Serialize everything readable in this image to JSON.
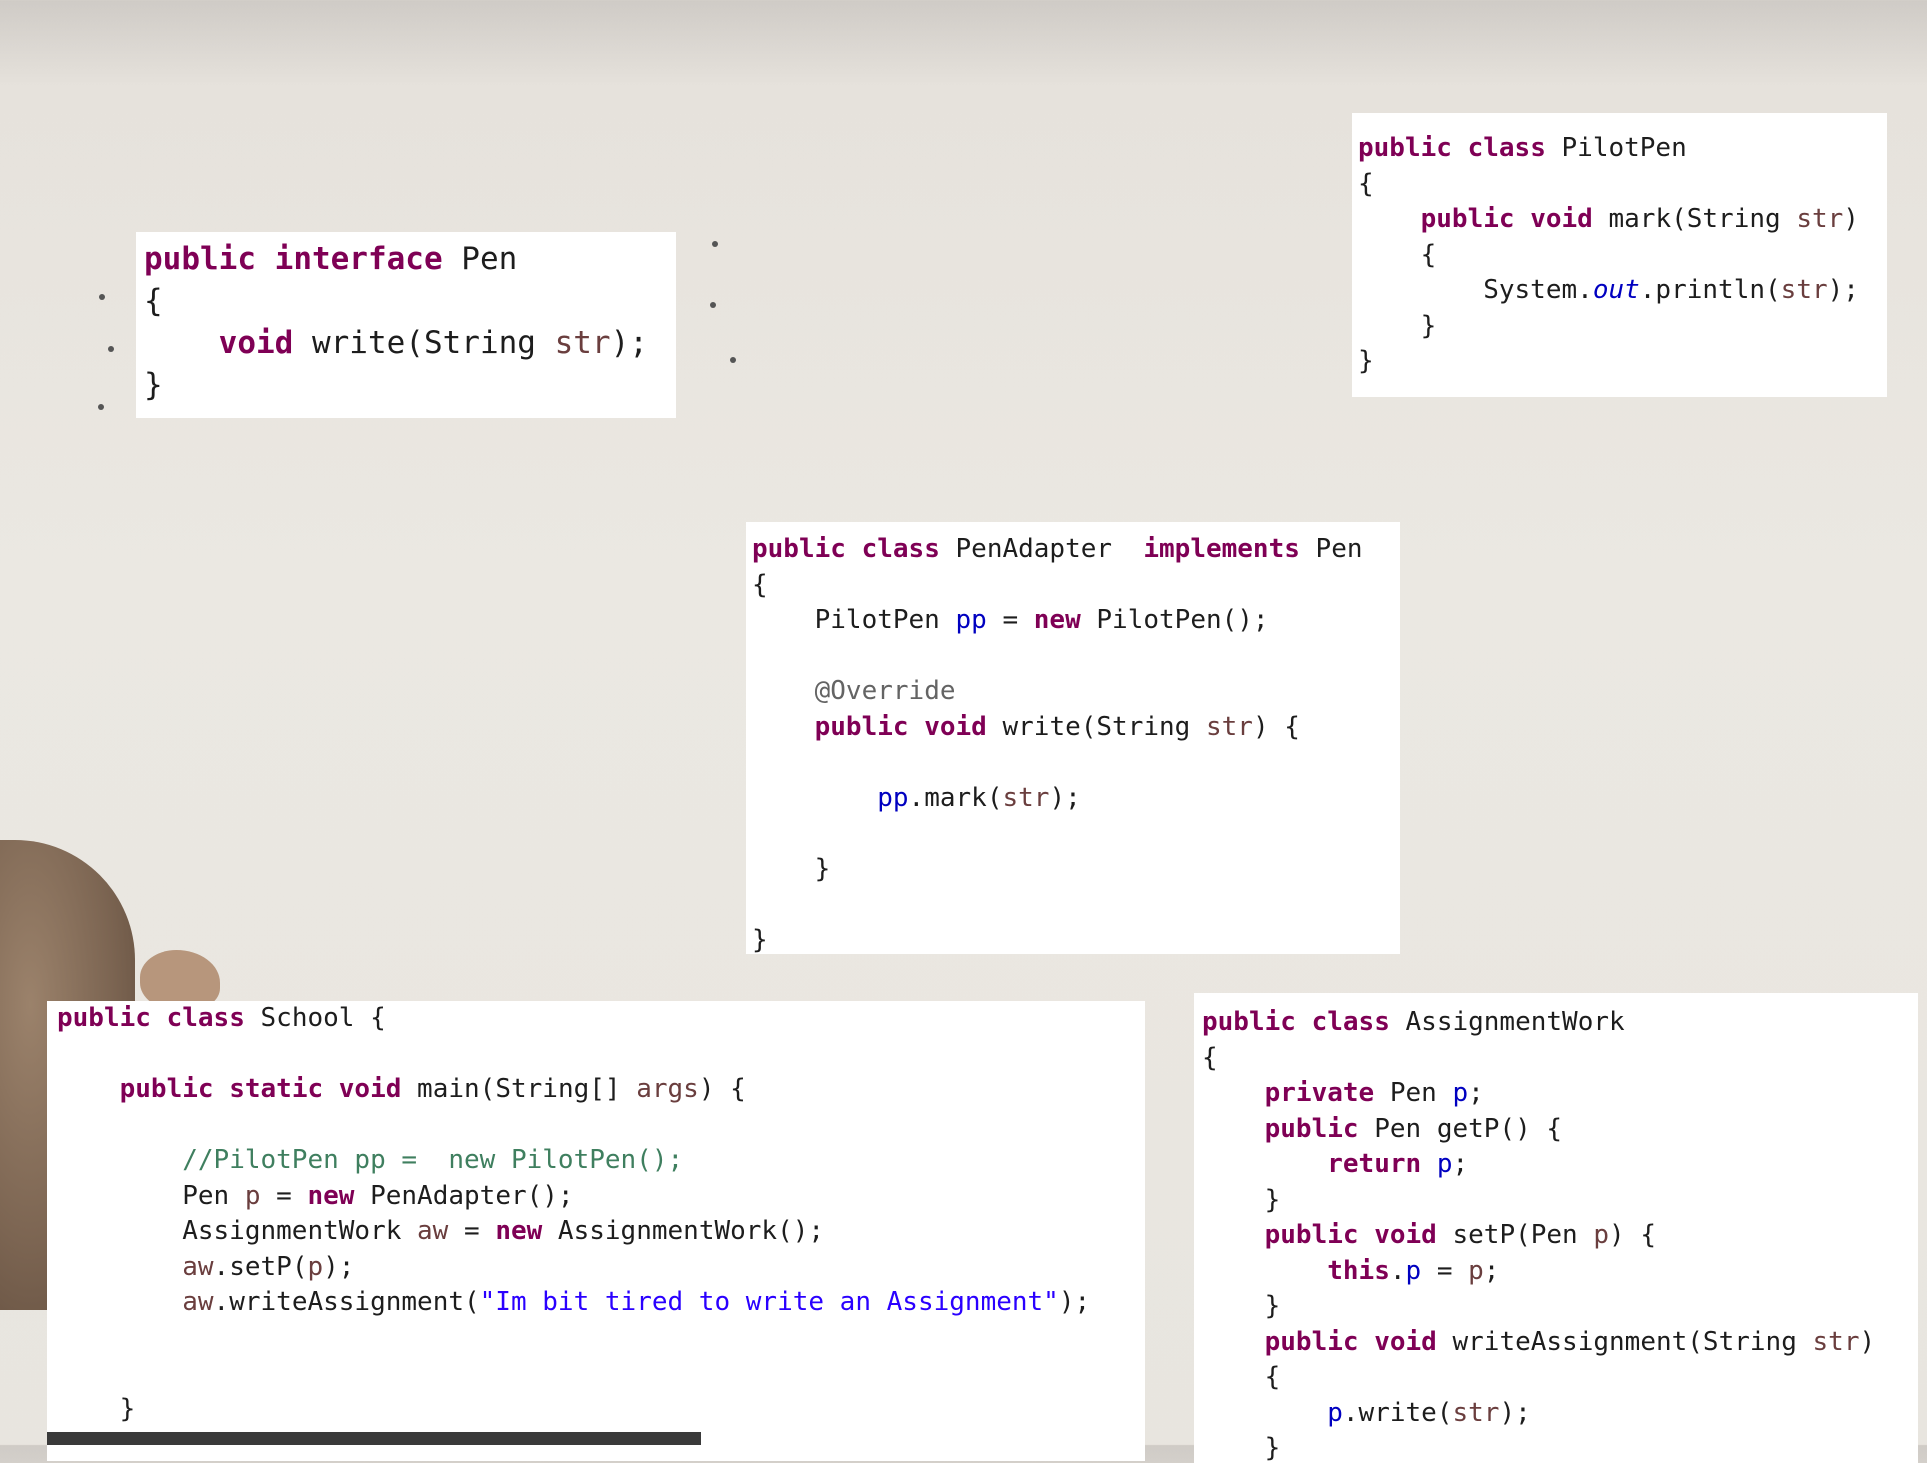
{
  "snippets": {
    "pen": [
      [
        {
          "t": "public",
          "c": "kw"
        },
        {
          "t": " "
        },
        {
          "t": "interface",
          "c": "kw"
        },
        {
          "t": " Pen"
        }
      ],
      [
        {
          "t": "{"
        }
      ],
      [
        {
          "t": "    "
        },
        {
          "t": "void",
          "c": "kw"
        },
        {
          "t": " write(String "
        },
        {
          "t": "str",
          "c": "var"
        },
        {
          "t": ");"
        }
      ],
      [
        {
          "t": "}"
        }
      ]
    ],
    "pilot_pen": [
      [
        {
          "t": "public",
          "c": "kw"
        },
        {
          "t": " "
        },
        {
          "t": "class",
          "c": "kw"
        },
        {
          "t": " PilotPen"
        }
      ],
      [
        {
          "t": "{"
        }
      ],
      [
        {
          "t": "    "
        },
        {
          "t": "public",
          "c": "kw"
        },
        {
          "t": " "
        },
        {
          "t": "void",
          "c": "kw"
        },
        {
          "t": " mark(String "
        },
        {
          "t": "str",
          "c": "var"
        },
        {
          "t": ")"
        }
      ],
      [
        {
          "t": "    {"
        }
      ],
      [
        {
          "t": "        System."
        },
        {
          "t": "out",
          "c": "st"
        },
        {
          "t": ".println("
        },
        {
          "t": "str",
          "c": "var"
        },
        {
          "t": ");"
        }
      ],
      [
        {
          "t": "    }"
        }
      ],
      [
        {
          "t": "}"
        }
      ]
    ],
    "pen_adapter": [
      [
        {
          "t": "public",
          "c": "kw"
        },
        {
          "t": " "
        },
        {
          "t": "class",
          "c": "kw"
        },
        {
          "t": " PenAdapter  "
        },
        {
          "t": "implements",
          "c": "kw"
        },
        {
          "t": " Pen"
        }
      ],
      [
        {
          "t": "{"
        }
      ],
      [
        {
          "t": "    PilotPen "
        },
        {
          "t": "pp",
          "c": "fld"
        },
        {
          "t": " = "
        },
        {
          "t": "new",
          "c": "kw"
        },
        {
          "t": " PilotPen();"
        }
      ],
      [
        {
          "t": ""
        }
      ],
      [
        {
          "t": "    "
        },
        {
          "t": "@Override",
          "c": "an"
        }
      ],
      [
        {
          "t": "    "
        },
        {
          "t": "public",
          "c": "kw"
        },
        {
          "t": " "
        },
        {
          "t": "void",
          "c": "kw"
        },
        {
          "t": " write(String "
        },
        {
          "t": "str",
          "c": "var"
        },
        {
          "t": ") {"
        }
      ],
      [
        {
          "t": ""
        }
      ],
      [
        {
          "t": "        "
        },
        {
          "t": "pp",
          "c": "fld"
        },
        {
          "t": ".mark("
        },
        {
          "t": "str",
          "c": "var"
        },
        {
          "t": ");"
        }
      ],
      [
        {
          "t": ""
        }
      ],
      [
        {
          "t": "    }"
        }
      ],
      [
        {
          "t": ""
        }
      ],
      [
        {
          "t": "}"
        }
      ]
    ],
    "school": [
      [
        {
          "t": "public",
          "c": "kw"
        },
        {
          "t": " "
        },
        {
          "t": "class",
          "c": "kw"
        },
        {
          "t": " School {"
        }
      ],
      [
        {
          "t": ""
        }
      ],
      [
        {
          "t": "    "
        },
        {
          "t": "public",
          "c": "kw"
        },
        {
          "t": " "
        },
        {
          "t": "static",
          "c": "kw"
        },
        {
          "t": " "
        },
        {
          "t": "void",
          "c": "kw"
        },
        {
          "t": " main(String[] "
        },
        {
          "t": "args",
          "c": "var"
        },
        {
          "t": ") {"
        }
      ],
      [
        {
          "t": ""
        }
      ],
      [
        {
          "t": "        "
        },
        {
          "t": "//PilotPen pp =  new PilotPen();",
          "c": "cm"
        }
      ],
      [
        {
          "t": "        Pen "
        },
        {
          "t": "p",
          "c": "var"
        },
        {
          "t": " = "
        },
        {
          "t": "new",
          "c": "kw"
        },
        {
          "t": " PenAdapter();"
        }
      ],
      [
        {
          "t": "        AssignmentWork "
        },
        {
          "t": "aw",
          "c": "var"
        },
        {
          "t": " = "
        },
        {
          "t": "new",
          "c": "kw"
        },
        {
          "t": " AssignmentWork();"
        }
      ],
      [
        {
          "t": "        "
        },
        {
          "t": "aw",
          "c": "var"
        },
        {
          "t": ".setP("
        },
        {
          "t": "p",
          "c": "var"
        },
        {
          "t": ");"
        }
      ],
      [
        {
          "t": "        "
        },
        {
          "t": "aw",
          "c": "var"
        },
        {
          "t": ".writeAssignment("
        },
        {
          "t": "\"Im bit tired to write an Assignment\"",
          "c": "str"
        },
        {
          "t": ");"
        }
      ],
      [
        {
          "t": ""
        }
      ],
      [
        {
          "t": ""
        }
      ],
      [
        {
          "t": "    }"
        }
      ]
    ],
    "assignment_work": [
      [
        {
          "t": "public",
          "c": "kw"
        },
        {
          "t": " "
        },
        {
          "t": "class",
          "c": "kw"
        },
        {
          "t": " AssignmentWork"
        }
      ],
      [
        {
          "t": "{"
        }
      ],
      [
        {
          "t": "    "
        },
        {
          "t": "private",
          "c": "kw"
        },
        {
          "t": " Pen "
        },
        {
          "t": "p",
          "c": "fld"
        },
        {
          "t": ";"
        }
      ],
      [
        {
          "t": "    "
        },
        {
          "t": "public",
          "c": "kw"
        },
        {
          "t": " Pen getP() {"
        }
      ],
      [
        {
          "t": "        "
        },
        {
          "t": "return",
          "c": "kw"
        },
        {
          "t": " "
        },
        {
          "t": "p",
          "c": "fld"
        },
        {
          "t": ";"
        }
      ],
      [
        {
          "t": "    }"
        }
      ],
      [
        {
          "t": "    "
        },
        {
          "t": "public",
          "c": "kw"
        },
        {
          "t": " "
        },
        {
          "t": "void",
          "c": "kw"
        },
        {
          "t": " setP(Pen "
        },
        {
          "t": "p",
          "c": "var"
        },
        {
          "t": ") {"
        }
      ],
      [
        {
          "t": "        "
        },
        {
          "t": "this",
          "c": "kw"
        },
        {
          "t": "."
        },
        {
          "t": "p",
          "c": "fld"
        },
        {
          "t": " = "
        },
        {
          "t": "p",
          "c": "var"
        },
        {
          "t": ";"
        }
      ],
      [
        {
          "t": "    }"
        }
      ],
      [
        {
          "t": "    "
        },
        {
          "t": "public",
          "c": "kw"
        },
        {
          "t": " "
        },
        {
          "t": "void",
          "c": "kw"
        },
        {
          "t": " writeAssignment(String "
        },
        {
          "t": "str",
          "c": "var"
        },
        {
          "t": ")"
        }
      ],
      [
        {
          "t": "    {"
        }
      ],
      [
        {
          "t": "        "
        },
        {
          "t": "p",
          "c": "fld"
        },
        {
          "t": ".write("
        },
        {
          "t": "str",
          "c": "var"
        },
        {
          "t": ");"
        }
      ],
      [
        {
          "t": "    }"
        }
      ]
    ]
  },
  "colors": {
    "keyword": "#7f0055",
    "field": "#0000c0",
    "local_variable": "#6a3e3e",
    "comment": "#3f7f5f",
    "annotation": "#646464",
    "string": "#2a00ff"
  }
}
